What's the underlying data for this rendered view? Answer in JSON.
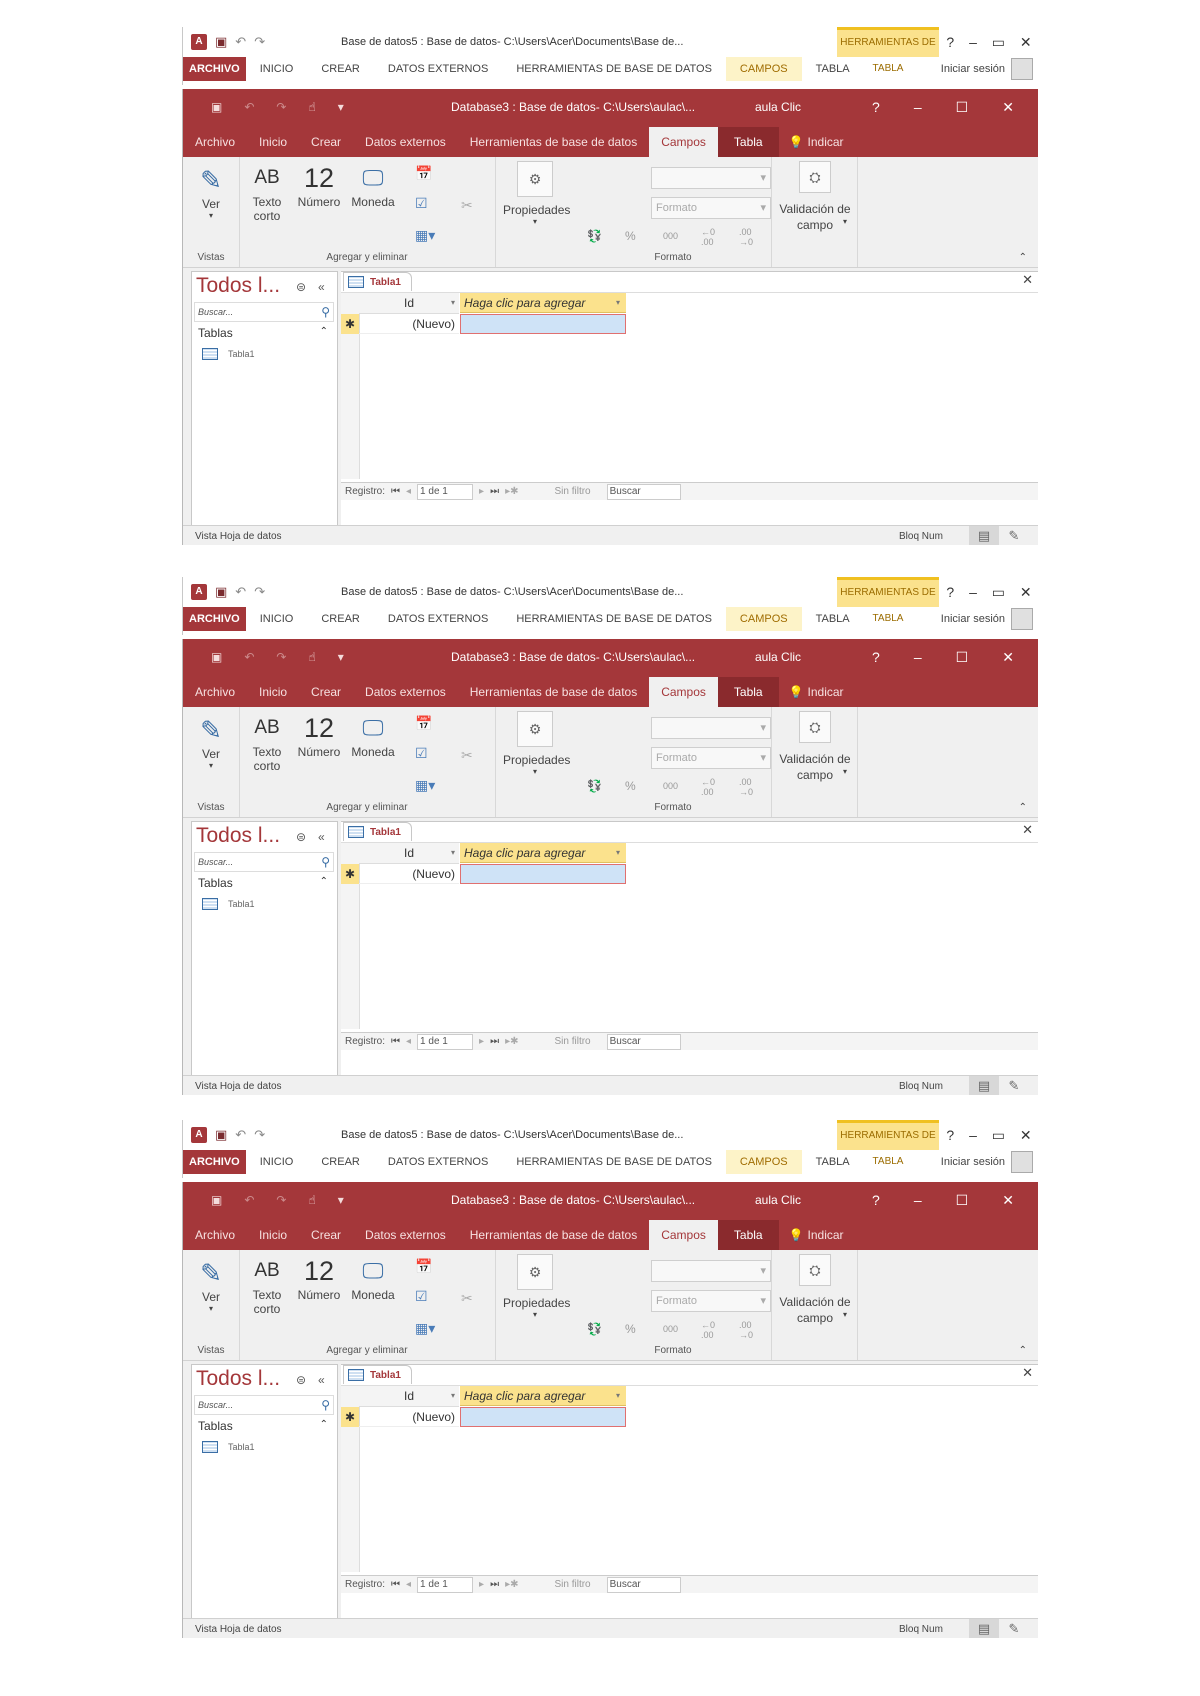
{
  "shots": [
    {
      "back": {
        "doc_title": "Base de datos5 : Base de datos- C:\\Users\\Acer\\Documents\\Base de...",
        "context_group": "HERRAMIENTAS DE TABLA",
        "file_tab": "ARCHIVO",
        "tabs": [
          "INICIO",
          "CREAR",
          "DATOS EXTERNOS",
          "HERRAMIENTAS DE BASE DE DATOS",
          "CAMPOS",
          "TABLA"
        ],
        "signin": "Iniciar sesión",
        "help": "?"
      },
      "front": {
        "title": "Database3 : Base de datos- C:\\Users\\aulac\\...",
        "user": "aula Clic",
        "help": "?",
        "tabs": [
          "Archivo",
          "Inicio",
          "Crear",
          "Datos externos",
          "Herramientas de base de datos",
          "Campos",
          "Tabla"
        ],
        "tell_me": "Indicar",
        "ribbon": {
          "view_label": "Ver",
          "group_vistas": "Vistas",
          "short_text_icon": "AB",
          "short_text_label": "Texto corto",
          "number_icon": "12",
          "number_label": "Número",
          "currency_label": "Moneda",
          "properties_label": "Propiedades",
          "group_add_delete": "Agregar y eliminar",
          "format_placeholder": "Formato",
          "group_format": "Formato",
          "validation_label": "Validación de campo"
        },
        "nav": {
          "title": "Todos l...",
          "search_placeholder": "Buscar...",
          "section": "Tablas",
          "item": "Tabla1"
        },
        "doc_tab": "Tabla1",
        "grid": {
          "col_id": "Id",
          "col_add": "Haga clic para agregar",
          "new_row": "(Nuevo)"
        },
        "records": {
          "label": "Registro:",
          "position": "1 de 1",
          "filter": "Sin filtro",
          "search": "Buscar"
        },
        "status": {
          "view": "Vista Hoja de datos",
          "numlock": "Bloq Num"
        }
      }
    },
    {
      "back": {
        "doc_title": "Base de datos5 : Base de datos- C:\\Users\\Acer\\Documents\\Base de...",
        "context_group": "HERRAMIENTAS DE TABLA",
        "file_tab": "ARCHIVO",
        "tabs": [
          "INICIO",
          "CREAR",
          "DATOS EXTERNOS",
          "HERRAMIENTAS DE BASE DE DATOS",
          "CAMPOS",
          "TABLA"
        ],
        "signin": "Iniciar sesión",
        "help": "?"
      },
      "front": {
        "title": "Database3 : Base de datos- C:\\Users\\aulac\\...",
        "user": "aula Clic",
        "help": "?",
        "tabs": [
          "Archivo",
          "Inicio",
          "Crear",
          "Datos externos",
          "Herramientas de base de datos",
          "Campos",
          "Tabla"
        ],
        "tell_me": "Indicar",
        "ribbon": {
          "view_label": "Ver",
          "group_vistas": "Vistas",
          "short_text_icon": "AB",
          "short_text_label": "Texto corto",
          "number_icon": "12",
          "number_label": "Número",
          "currency_label": "Moneda",
          "properties_label": "Propiedades",
          "group_add_delete": "Agregar y eliminar",
          "format_placeholder": "Formato",
          "group_format": "Formato",
          "validation_label": "Validación de campo"
        },
        "nav": {
          "title": "Todos l...",
          "search_placeholder": "Buscar...",
          "section": "Tablas",
          "item": "Tabla1"
        },
        "doc_tab": "Tabla1",
        "grid": {
          "col_id": "Id",
          "col_add": "Haga clic para agregar",
          "new_row": "(Nuevo)"
        },
        "records": {
          "label": "Registro:",
          "position": "1 de 1",
          "filter": "Sin filtro",
          "search": "Buscar"
        },
        "status": {
          "view": "Vista Hoja de datos",
          "numlock": "Bloq Num"
        }
      }
    },
    {
      "back": {
        "doc_title": "Base de datos5 : Base de datos- C:\\Users\\Acer\\Documents\\Base de...",
        "context_group": "HERRAMIENTAS DE TABLA",
        "file_tab": "ARCHIVO",
        "tabs": [
          "INICIO",
          "CREAR",
          "DATOS EXTERNOS",
          "HERRAMIENTAS DE BASE DE DATOS",
          "CAMPOS",
          "TABLA"
        ],
        "signin": "Iniciar sesión",
        "help": "?"
      },
      "front": {
        "title": "Database3 : Base de datos- C:\\Users\\aulac\\...",
        "user": "aula Clic",
        "help": "?",
        "tabs": [
          "Archivo",
          "Inicio",
          "Crear",
          "Datos externos",
          "Herramientas de base de datos",
          "Campos",
          "Tabla"
        ],
        "tell_me": "Indicar",
        "ribbon": {
          "view_label": "Ver",
          "group_vistas": "Vistas",
          "short_text_icon": "AB",
          "short_text_label": "Texto corto",
          "number_icon": "12",
          "number_label": "Número",
          "currency_label": "Moneda",
          "properties_label": "Propiedades",
          "group_add_delete": "Agregar y eliminar",
          "format_placeholder": "Formato",
          "group_format": "Formato",
          "validation_label": "Validación de campo"
        },
        "nav": {
          "title": "Todos l...",
          "search_placeholder": "Buscar...",
          "section": "Tablas",
          "item": "Tabla1"
        },
        "doc_tab": "Tabla1",
        "grid": {
          "col_id": "Id",
          "col_add": "Haga clic para agregar",
          "new_row": "(Nuevo)"
        },
        "records": {
          "label": "Registro:",
          "position": "1 de 1",
          "filter": "Sin filtro",
          "search": "Buscar"
        },
        "status": {
          "view": "Vista Hoja de datos",
          "numlock": "Bloq Num"
        }
      }
    }
  ]
}
